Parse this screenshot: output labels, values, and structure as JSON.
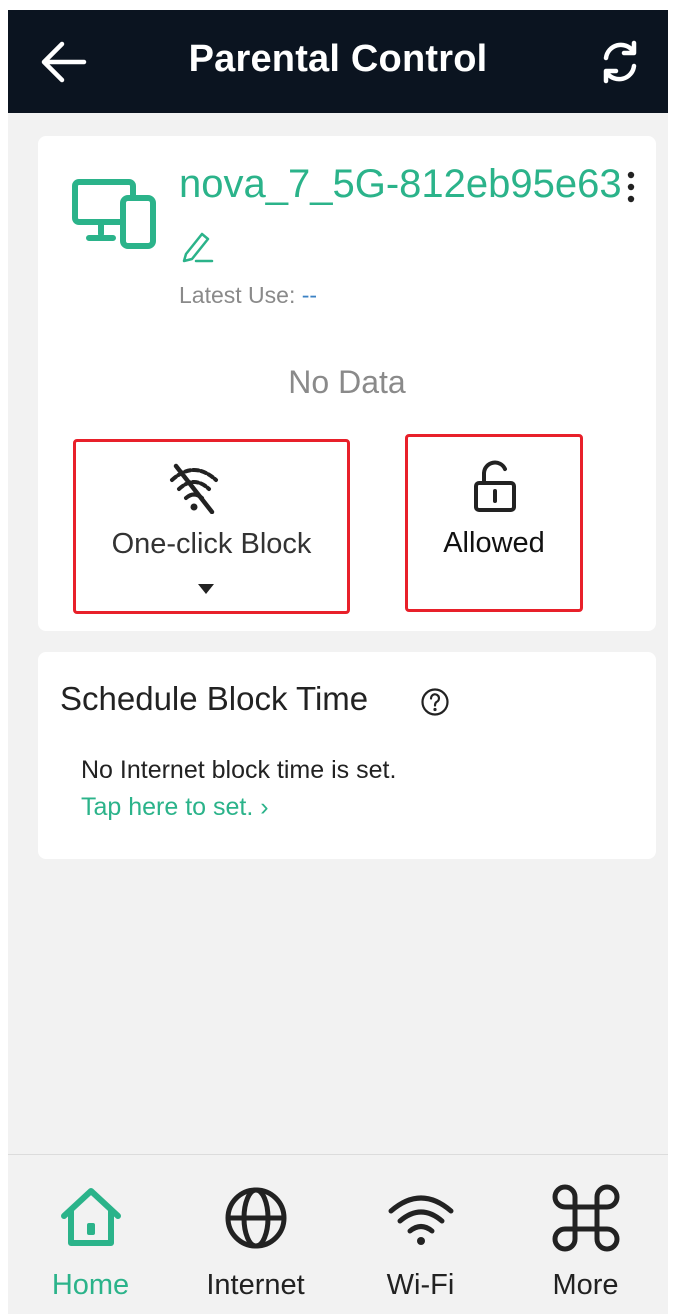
{
  "header": {
    "title": "Parental Control",
    "back_icon": "arrow-left-icon",
    "refresh_icon": "refresh-icon"
  },
  "device": {
    "name": "nova_7_5G-812eb95e63",
    "latest_use_label": "Latest Use:",
    "latest_use_value": "--",
    "icon": "devices-icon",
    "no_data": "No Data"
  },
  "actions": {
    "block_label": "One-click Block",
    "block_icon": "wifi-off-icon",
    "allowed_label": "Allowed",
    "allowed_icon": "unlock-icon"
  },
  "schedule": {
    "title": "Schedule Block Time",
    "message": "No Internet block time is set.",
    "link": "Tap here to set. ›"
  },
  "tabs": [
    {
      "label": "Home",
      "icon": "home-icon",
      "active": true
    },
    {
      "label": "Internet",
      "icon": "globe-icon",
      "active": false
    },
    {
      "label": "Wi-Fi",
      "icon": "wifi-icon",
      "active": false
    },
    {
      "label": "More",
      "icon": "more-apps-icon",
      "active": false
    }
  ],
  "colors": {
    "accent": "#2bb38a",
    "header_bg": "#0b1420",
    "highlight_border": "#e8202a",
    "background": "#f2f2f2"
  }
}
